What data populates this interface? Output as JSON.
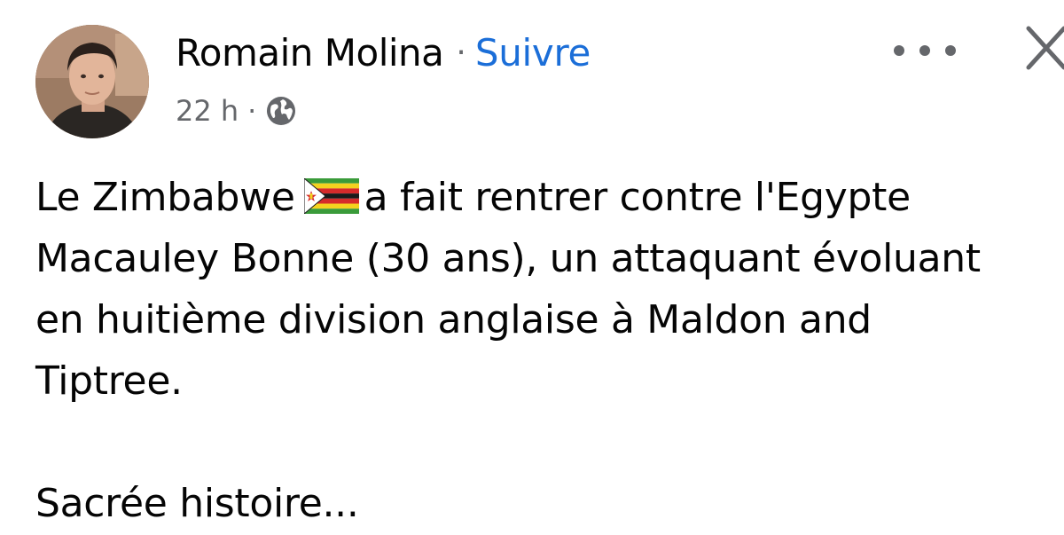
{
  "post": {
    "author": {
      "name": "Romain Molina",
      "separator": "·",
      "follow_label": "Suivre"
    },
    "meta": {
      "time": "22 h",
      "separator": "·",
      "audience_icon": "globe-icon"
    },
    "actions": {
      "more_icon": "more-horizontal-icon",
      "close_icon": "close-icon"
    },
    "body": {
      "line1_before_flag": "Le Zimbabwe",
      "flag_icon": "zimbabwe-flag-icon",
      "line1_after_flag": "a fait rentrer contre l'Egypte",
      "line2": "Macauley Bonne (30 ans), un attaquant évoluant",
      "line3": "en huitième division anglaise à Maldon and",
      "line4": "Tiptree.",
      "line5": "Sacrée histoire..."
    },
    "colors": {
      "link": "#1b6ed8",
      "secondary_text": "#65676b",
      "primary_text": "#050505"
    }
  }
}
